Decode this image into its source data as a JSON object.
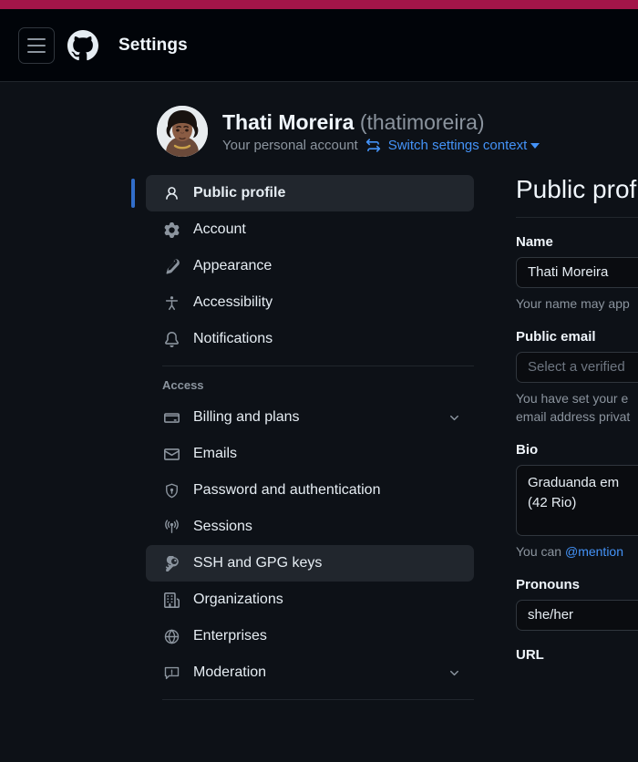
{
  "theme": {
    "accent_bar_color": "#a31549",
    "page_bg": "#0d1117",
    "header_bg": "#010409",
    "link_blue": "#4493f8",
    "selected_indicator": "#316dca",
    "selected_bg": "#21262d"
  },
  "header": {
    "menu_icon": "hamburger-menu-icon",
    "logo_icon": "github-logo-icon",
    "title": "Settings"
  },
  "profile": {
    "avatar_alt": "user-avatar",
    "name": "Thati Moreira",
    "handle": "(thatimoreira)",
    "account_type": "Your personal account",
    "switch_icon": "arrow-switch-icon",
    "switch_label": "Switch settings context",
    "caret_icon": "chevron-down-icon"
  },
  "sidebar": {
    "primary_items": [
      {
        "label": "Public profile",
        "icon": "person-icon",
        "selected": true,
        "chevron": false
      },
      {
        "label": "Account",
        "icon": "gear-icon",
        "selected": false,
        "chevron": false
      },
      {
        "label": "Appearance",
        "icon": "paintbrush-icon",
        "selected": false,
        "chevron": false
      },
      {
        "label": "Accessibility",
        "icon": "accessibility-icon",
        "selected": false,
        "chevron": false
      },
      {
        "label": "Notifications",
        "icon": "bell-icon",
        "selected": false,
        "chevron": false
      }
    ],
    "access_section": {
      "title": "Access",
      "items": [
        {
          "label": "Billing and plans",
          "icon": "credit-card-icon",
          "selected": false,
          "chevron": true
        },
        {
          "label": "Emails",
          "icon": "mail-icon",
          "selected": false,
          "chevron": false
        },
        {
          "label": "Password and authentication",
          "icon": "shield-lock-icon",
          "selected": false,
          "chevron": false
        },
        {
          "label": "Sessions",
          "icon": "broadcast-icon",
          "selected": false,
          "chevron": false
        },
        {
          "label": "SSH and GPG keys",
          "icon": "key-icon",
          "selected": false,
          "hovered": true,
          "chevron": false
        },
        {
          "label": "Organizations",
          "icon": "organization-icon",
          "selected": false,
          "chevron": false
        },
        {
          "label": "Enterprises",
          "icon": "globe-icon",
          "selected": false,
          "chevron": false
        },
        {
          "label": "Moderation",
          "icon": "report-icon",
          "selected": false,
          "chevron": true
        }
      ]
    }
  },
  "main": {
    "heading": "Public profile",
    "fields": {
      "name": {
        "label": "Name",
        "value": "Thati Moreira",
        "help": "Your name may app"
      },
      "public_email": {
        "label": "Public email",
        "placeholder": "Select a verified",
        "help": "You have set your e\nemail address privat"
      },
      "bio": {
        "label": "Bio",
        "value": "Graduanda em\n(42 Rio)",
        "help_prefix": "You can ",
        "help_mention": "@mention"
      },
      "pronouns": {
        "label": "Pronouns",
        "value": "she/her"
      },
      "url": {
        "label": "URL"
      }
    }
  }
}
